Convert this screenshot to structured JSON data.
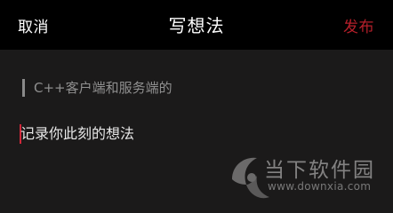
{
  "header": {
    "cancel_label": "取消",
    "title": "写想法",
    "publish_label": "发布"
  },
  "quote": {
    "text": "C++客户端和服务端的"
  },
  "editor": {
    "placeholder": "记录你此刻的想法"
  },
  "watermark": {
    "site_name": "当下软件园",
    "url": "www.downxia.com"
  },
  "colors": {
    "accent": "#b51f2a",
    "background": "#1b1a1a",
    "header_background": "#000000"
  }
}
